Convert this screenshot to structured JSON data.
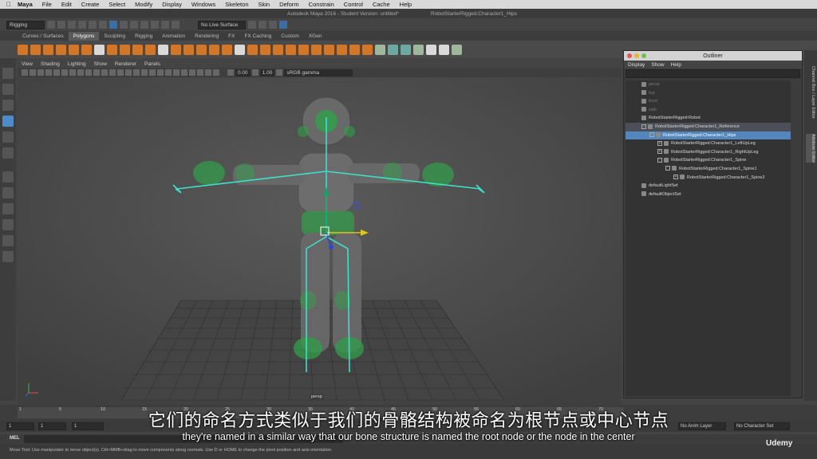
{
  "macbar": {
    "app": "Maya",
    "menus": [
      "File",
      "Edit",
      "Create",
      "Select",
      "Modify",
      "Display",
      "Windows",
      "Skeleton",
      "Skin",
      "Deform",
      "Constrain",
      "Control",
      "Cache",
      "Help"
    ]
  },
  "titlebar": {
    "title": "Autodesk Maya 2016 - Student Version: untitled*",
    "node": "RobotStarterRigged:Character1_Hips"
  },
  "toolbar": {
    "mode": "Rigging",
    "live_surface": "No Live Surface"
  },
  "shelf": {
    "tabs": [
      "Curves / Surfaces",
      "Polygons",
      "Sculpting",
      "Rigging",
      "Animation",
      "Rendering",
      "FX",
      "FX Caching",
      "Custom",
      "XGen"
    ],
    "active": "Polygons"
  },
  "viewport": {
    "menus": [
      "View",
      "Shading",
      "Lighting",
      "Show",
      "Renderer",
      "Panels"
    ],
    "exposure": "0.00",
    "gamma": "1.00",
    "color_space": "sRGB gamma",
    "camera": "persp"
  },
  "outliner": {
    "title": "Outliner",
    "menus": [
      "Display",
      "Show",
      "Help"
    ],
    "items": [
      {
        "label": "persp",
        "indent": 0,
        "state": "dim",
        "exp": ""
      },
      {
        "label": "top",
        "indent": 0,
        "state": "dim",
        "exp": ""
      },
      {
        "label": "front",
        "indent": 0,
        "state": "dim",
        "exp": ""
      },
      {
        "label": "side",
        "indent": 0,
        "state": "dim",
        "exp": ""
      },
      {
        "label": "RobotStarterRigged:Robot",
        "indent": 0,
        "state": "",
        "exp": ""
      },
      {
        "label": "RobotStarterRigged:Character1_Reference",
        "indent": 0,
        "state": "hl",
        "exp": "-"
      },
      {
        "label": "RobotStarterRigged:Character1_Hips",
        "indent": 1,
        "state": "sel",
        "exp": "-"
      },
      {
        "label": "RobotStarterRigged:Character1_LeftUpLeg",
        "indent": 2,
        "state": "",
        "exp": "+"
      },
      {
        "label": "RobotStarterRigged:Character1_RightUpLeg",
        "indent": 2,
        "state": "",
        "exp": "+"
      },
      {
        "label": "RobotStarterRigged:Character1_Spine",
        "indent": 2,
        "state": "",
        "exp": "-"
      },
      {
        "label": "RobotStarterRigged:Character1_Spine1",
        "indent": 3,
        "state": "",
        "exp": "-"
      },
      {
        "label": "RobotStarterRigged:Character1_Spine2",
        "indent": 4,
        "state": "",
        "exp": "+"
      },
      {
        "label": "defaultLightSet",
        "indent": 0,
        "state": "",
        "exp": ""
      },
      {
        "label": "defaultObjectSet",
        "indent": 0,
        "state": "",
        "exp": ""
      }
    ]
  },
  "sidetabs": {
    "channel_box": "Channel Box / Layer Editor",
    "attr_editor": "Attribute Editor"
  },
  "timeline": {
    "ticks": [
      "1",
      "5",
      "10",
      "15",
      "20",
      "25",
      "30",
      "35",
      "40",
      "45",
      "50",
      "55",
      "60",
      "65",
      "70"
    ]
  },
  "range": {
    "start": "1",
    "start2": "1",
    "current": "1",
    "anim_layer": "No Anim Layer",
    "char_set": "No Character Set"
  },
  "mel": {
    "label": "MEL"
  },
  "help": {
    "text": "Move Tool: Use manipulator to move object(s). Ctrl+MMB+drag to move components along normals. Use D or HOME to change the pivot position and axis orientation."
  },
  "subtitles": {
    "zh": "它们的命名方式类似于我们的骨骼结构被命名为根节点或中心节点",
    "en": "they're named in a similar way that our bone structure is named the root node or the node in the center"
  },
  "watermark": "Udemy"
}
